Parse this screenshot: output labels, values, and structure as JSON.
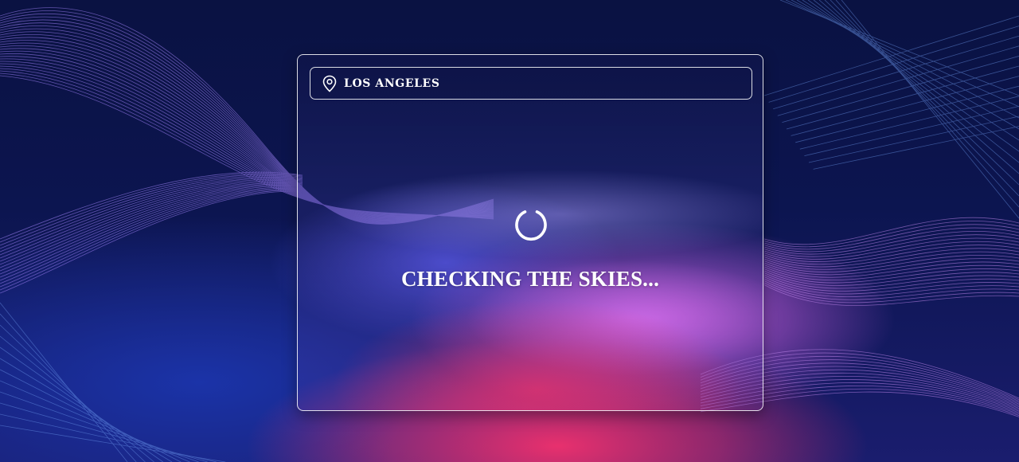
{
  "location": {
    "icon": "map-pin-icon",
    "name": "LOS ANGELES"
  },
  "loader": {
    "icon": "loading-spinner-icon",
    "status": "CHECKING THE SKIES..."
  },
  "colors": {
    "background": "#0a1242",
    "accent_pink": "#e8306e",
    "accent_purple": "#c05ad8",
    "accent_blue": "#4d50d8",
    "text": "#ffffff"
  }
}
